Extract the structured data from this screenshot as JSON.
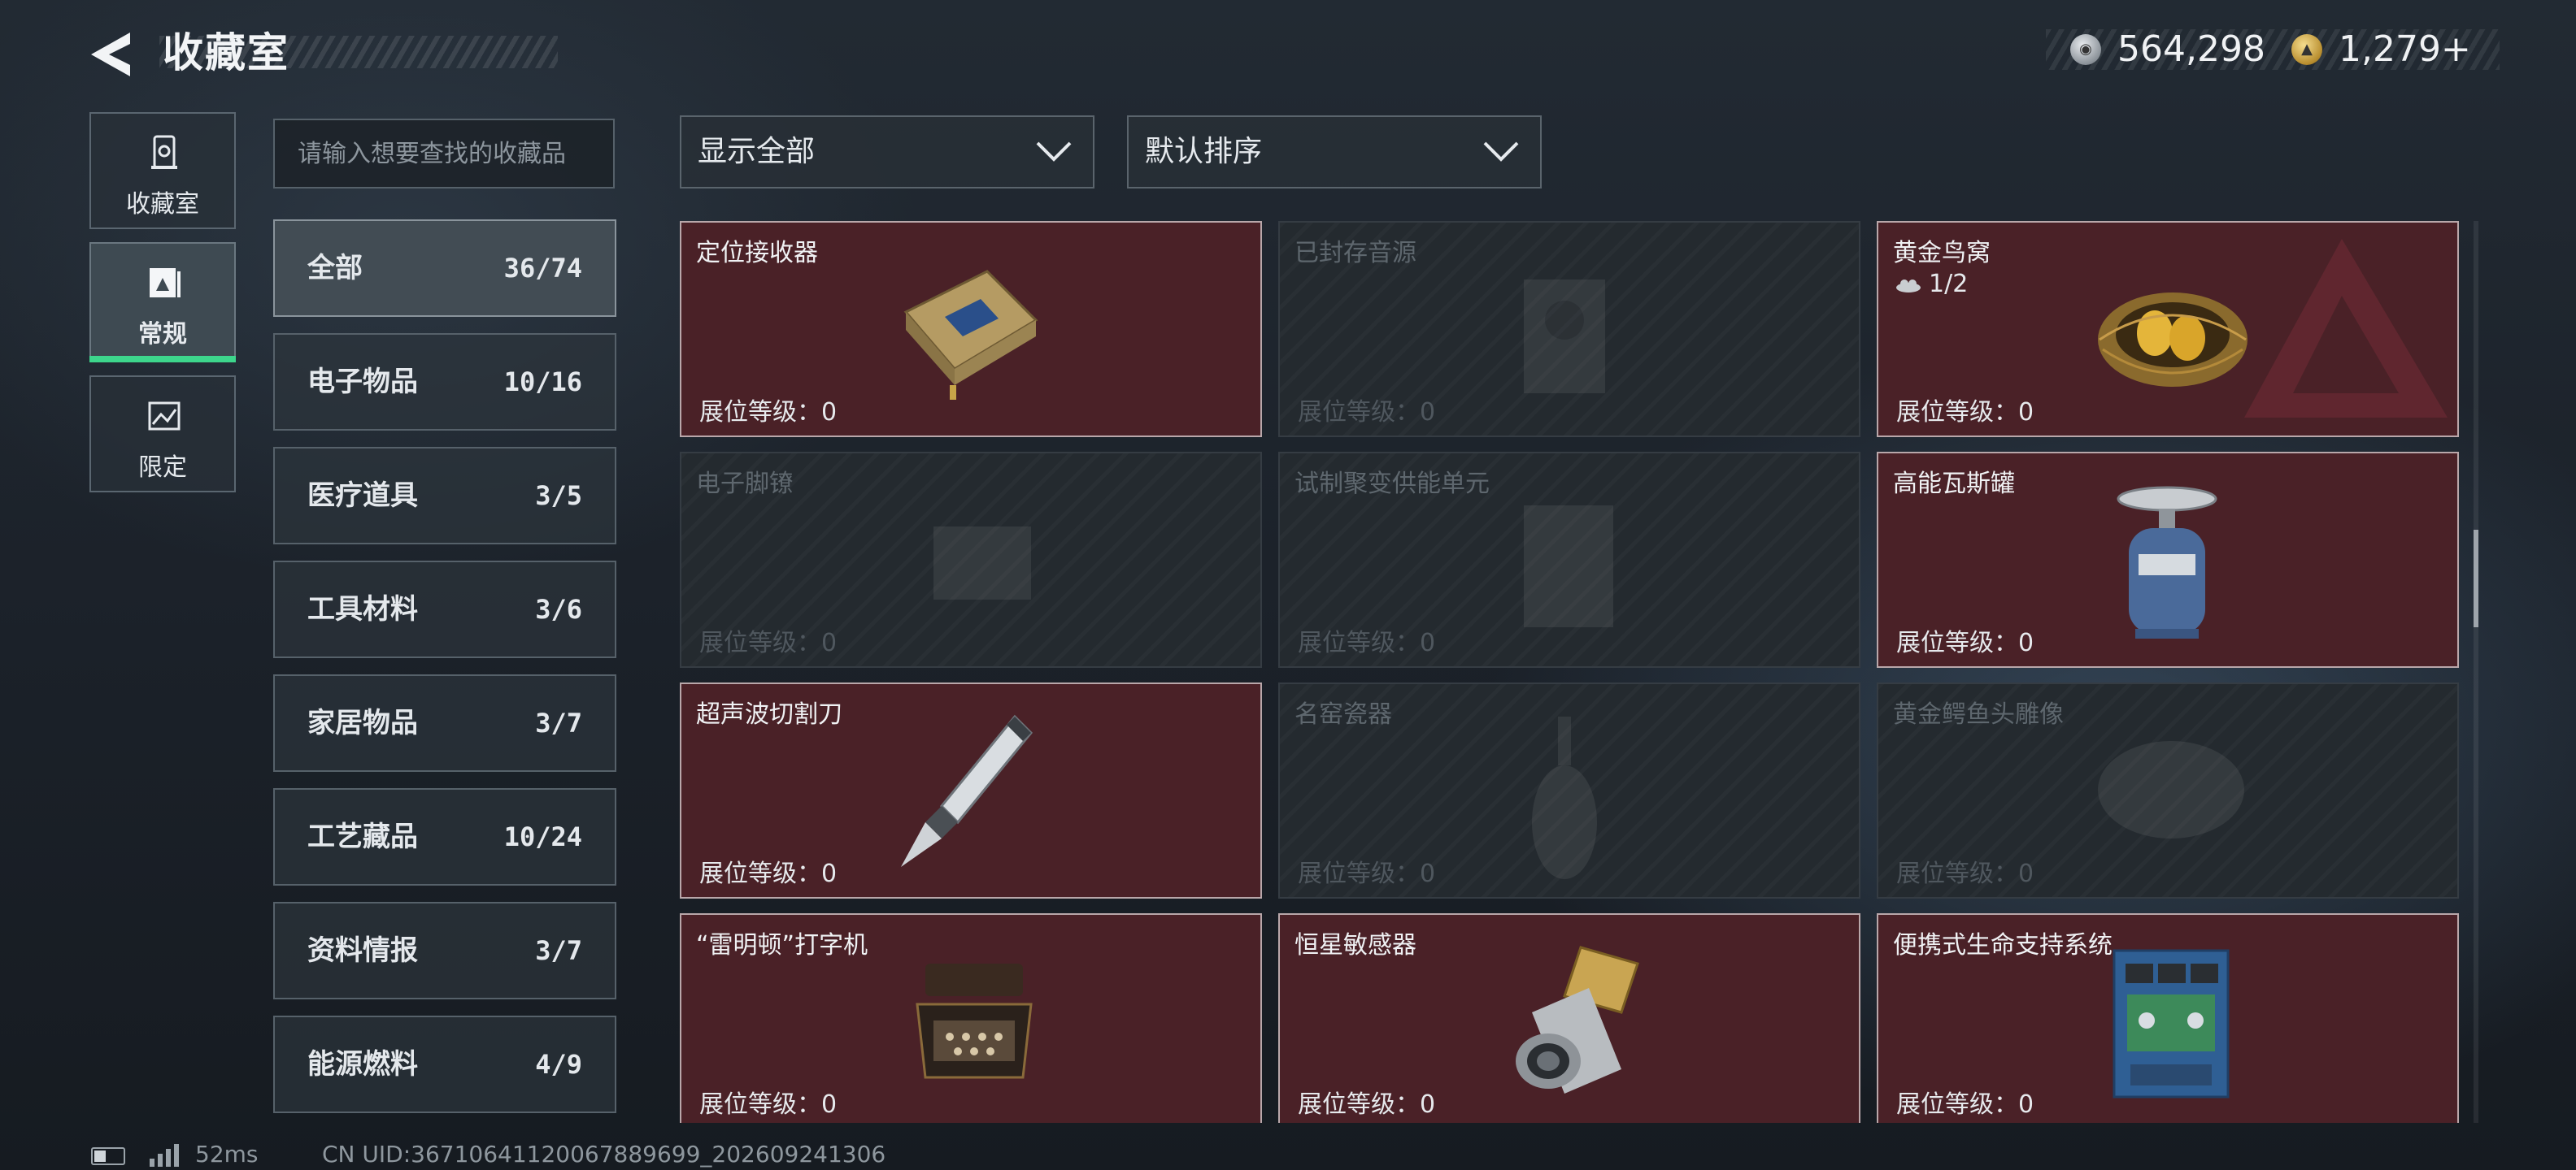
{
  "header": {
    "title": "收藏室",
    "back_icon": "back-arrow-icon",
    "currency": {
      "silver_icon": "silver-coin-icon",
      "silver_value": "564,298",
      "gold_icon": "gold-coin-icon",
      "gold_value": "1,279+"
    }
  },
  "left_nav": [
    {
      "label": "收藏室",
      "icon": "vault-icon"
    },
    {
      "label": "常规",
      "icon": "regular-collection-icon",
      "active": true
    },
    {
      "label": "限定",
      "icon": "limited-collection-icon"
    }
  ],
  "search": {
    "placeholder": "请输入想要查找的收藏品",
    "value": ""
  },
  "categories": [
    {
      "name": "全部",
      "count": "36/74",
      "active": true
    },
    {
      "name": "电子物品",
      "count": "10/16"
    },
    {
      "name": "医疗道具",
      "count": "3/5"
    },
    {
      "name": "工具材料",
      "count": "3/6"
    },
    {
      "name": "家居物品",
      "count": "3/7"
    },
    {
      "name": "工艺藏品",
      "count": "10/24"
    },
    {
      "name": "资料情报",
      "count": "3/7"
    },
    {
      "name": "能源燃料",
      "count": "4/9"
    }
  ],
  "filters": {
    "show": {
      "selected": "显示全部",
      "icon": "chevron-down-icon"
    },
    "sort": {
      "selected": "默认排序",
      "icon": "chevron-down-icon"
    }
  },
  "items": [
    {
      "name": "定位接收器",
      "level_label": "展位等级：",
      "level": "0",
      "owned": true
    },
    {
      "name": "已封存音源",
      "level_label": "展位等级：",
      "level": "0",
      "owned": false
    },
    {
      "name": "黄金鸟窝",
      "level_label": "展位等级：",
      "level": "0",
      "owned": true,
      "quantity": "1/2"
    },
    {
      "name": "电子脚镣",
      "level_label": "展位等级：",
      "level": "0",
      "owned": false
    },
    {
      "name": "试制聚变供能单元",
      "level_label": "展位等级：",
      "level": "0",
      "owned": false
    },
    {
      "name": "高能瓦斯罐",
      "level_label": "展位等级：",
      "level": "0",
      "owned": true
    },
    {
      "name": "超声波切割刀",
      "level_label": "展位等级：",
      "level": "0",
      "owned": true
    },
    {
      "name": "名窑瓷器",
      "level_label": "展位等级：",
      "level": "0",
      "owned": false
    },
    {
      "name": "黄金鳄鱼头雕像",
      "level_label": "展位等级：",
      "level": "0",
      "owned": false
    },
    {
      "name": "“雷明顿”打字机",
      "level_label": "展位等级：",
      "level": "0",
      "owned": true
    },
    {
      "name": "恒星敏感器",
      "level_label": "展位等级：",
      "level": "0",
      "owned": true
    },
    {
      "name": "便携式生命支持系统",
      "level_label": "展位等级：",
      "level": "0",
      "owned": true
    }
  ],
  "status_bar": {
    "ping": "52ms",
    "uid": "CN UID:36710641120067889699_202609241306"
  },
  "colors": {
    "owned_card_bg": "#4a2127",
    "active_tab_underline": "#3dd68c",
    "locked_card_bg": "#242a2f"
  }
}
